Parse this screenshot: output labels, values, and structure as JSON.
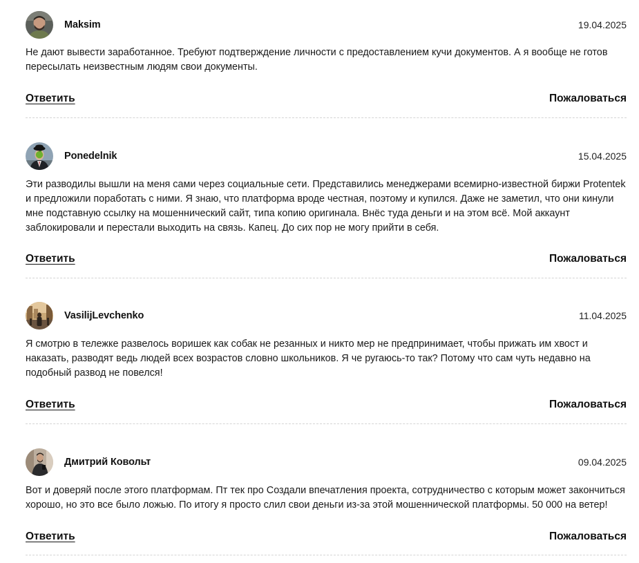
{
  "comments": [
    {
      "author": "Maksim",
      "date": "19.04.2025",
      "text": "Не дают вывести заработанное. Требуют подтверждение личности с предоставлением кучи документов. А я вообще не готов пересылать неизвестным людям свои документы.",
      "reply_label": "Ответить",
      "report_label": "Пожаловаться",
      "avatar": "avatar-photo-man-beard"
    },
    {
      "author": "Ponedelnik",
      "date": "15.04.2025",
      "text": "Эти разводилы вышли на меня сами через социальные сети. Представились менеджерами всемирно-известной биржи Protentek и предложили поработать с ними. Я знаю, что платформа вроде честная, поэтому и купился. Даже не заметил, что они кинули мне подставную ссылку на мошеннический сайт, типа копию оригинала. Внёс туда деньги и на этом всё. Мой аккаунт заблокировали и перестали выходить на связь. Капец. До сих пор не могу прийти в себя.",
      "reply_label": "Ответить",
      "report_label": "Пожаловаться",
      "avatar": "avatar-bowler-hat-apple"
    },
    {
      "author": "VasilijLevchenko",
      "date": "11.04.2025",
      "text": "Я смотрю в тележке развелось воришек как собак не резанных и никто мер не предпринимает, чтобы прижать им хвост и наказать, разводят ведь людей всех возрастов словно школьников. Я че ругаюсь-то так? Потому что сам чуть недавно на подобный развод не повелся!",
      "reply_label": "Ответить",
      "report_label": "Пожаловаться",
      "avatar": "avatar-street-photo"
    },
    {
      "author": "Дмитрий Ковольт",
      "date": "09.04.2025",
      "text": "Вот и доверяй после этого платформам. Пт тек про Создали впечатления проекта, сотрудничество с которым может закончиться хорошо, но это все было ложью. По итогу я просто слил свои деньги из-за этой мошеннической платформы. 50 000 на ветер!",
      "reply_label": "Ответить",
      "report_label": "Пожаловаться",
      "avatar": "avatar-photo-man-mirror"
    }
  ]
}
